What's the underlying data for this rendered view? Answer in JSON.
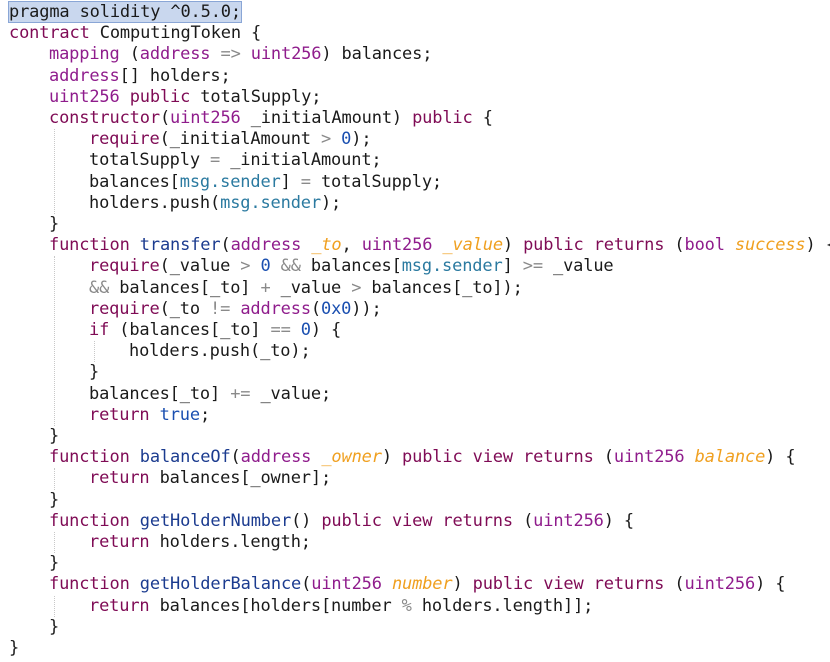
{
  "editor": {
    "language": "solidity",
    "colors": {
      "keyword": "#7f0b55",
      "type": "#8f1c8c",
      "operator": "#8a8a8a",
      "function_name": "#1b3b8f",
      "number": "#1a4fb0",
      "msg_sender": "#2b7aa0",
      "parameter": "#f0a020",
      "selection": "#c9d7ee"
    },
    "lines": [
      {
        "indent": 0,
        "tokens": [
          {
            "t": "pragma solidity ^0.5.0;",
            "c": "hl"
          }
        ]
      },
      {
        "indent": 0,
        "tokens": [
          {
            "t": "contract ",
            "c": "kw"
          },
          {
            "t": "ComputingToken {"
          }
        ]
      },
      {
        "indent": 1,
        "tokens": [
          {
            "t": "mapping",
            "c": "ty"
          },
          {
            "t": " ("
          },
          {
            "t": "address",
            "c": "ty"
          },
          {
            "t": " "
          },
          {
            "t": "=>",
            "c": "op"
          },
          {
            "t": " "
          },
          {
            "t": "uint256",
            "c": "ty"
          },
          {
            "t": ") balances;"
          }
        ]
      },
      {
        "indent": 1,
        "tokens": [
          {
            "t": "address",
            "c": "ty"
          },
          {
            "t": "[] holders;"
          }
        ]
      },
      {
        "indent": 1,
        "tokens": [
          {
            "t": "uint256",
            "c": "ty"
          },
          {
            "t": " "
          },
          {
            "t": "public",
            "c": "kw"
          },
          {
            "t": " totalSupply;"
          }
        ]
      },
      {
        "indent": 1,
        "tokens": [
          {
            "t": "constructor",
            "c": "kw"
          },
          {
            "t": "("
          },
          {
            "t": "uint256",
            "c": "ty"
          },
          {
            "t": " _initialAmount) "
          },
          {
            "t": "public",
            "c": "kw"
          },
          {
            "t": " {"
          }
        ]
      },
      {
        "indent": 2,
        "tokens": [
          {
            "t": "require",
            "c": "kw"
          },
          {
            "t": "(_initialAmount "
          },
          {
            "t": ">",
            "c": "op"
          },
          {
            "t": " "
          },
          {
            "t": "0",
            "c": "num"
          },
          {
            "t": ");"
          }
        ]
      },
      {
        "indent": 2,
        "tokens": [
          {
            "t": "totalSupply "
          },
          {
            "t": "=",
            "c": "op"
          },
          {
            "t": " _initialAmount;"
          }
        ]
      },
      {
        "indent": 2,
        "tokens": [
          {
            "t": "balances["
          },
          {
            "t": "msg.sender",
            "c": "msg"
          },
          {
            "t": "] "
          },
          {
            "t": "=",
            "c": "op"
          },
          {
            "t": " totalSupply;"
          }
        ]
      },
      {
        "indent": 2,
        "tokens": [
          {
            "t": "holders.push("
          },
          {
            "t": "msg.sender",
            "c": "msg"
          },
          {
            "t": ");"
          }
        ]
      },
      {
        "indent": 1,
        "tokens": [
          {
            "t": "}"
          }
        ]
      },
      {
        "indent": 1,
        "tokens": [
          {
            "t": "function",
            "c": "kw"
          },
          {
            "t": " "
          },
          {
            "t": "transfer",
            "c": "fn"
          },
          {
            "t": "("
          },
          {
            "t": "address",
            "c": "ty"
          },
          {
            "t": " "
          },
          {
            "t": "_to",
            "c": "prm"
          },
          {
            "t": ", "
          },
          {
            "t": "uint256",
            "c": "ty"
          },
          {
            "t": " "
          },
          {
            "t": "_value",
            "c": "prm"
          },
          {
            "t": ") "
          },
          {
            "t": "public",
            "c": "kw"
          },
          {
            "t": " "
          },
          {
            "t": "returns",
            "c": "kw"
          },
          {
            "t": " ("
          },
          {
            "t": "bool",
            "c": "ty"
          },
          {
            "t": " "
          },
          {
            "t": "success",
            "c": "prm"
          },
          {
            "t": ") {"
          }
        ]
      },
      {
        "indent": 2,
        "tokens": [
          {
            "t": "require",
            "c": "kw"
          },
          {
            "t": "(_value "
          },
          {
            "t": ">",
            "c": "op"
          },
          {
            "t": " "
          },
          {
            "t": "0",
            "c": "num"
          },
          {
            "t": " "
          },
          {
            "t": "&&",
            "c": "op"
          },
          {
            "t": " balances["
          },
          {
            "t": "msg.sender",
            "c": "msg"
          },
          {
            "t": "] "
          },
          {
            "t": ">=",
            "c": "op"
          },
          {
            "t": " _value"
          }
        ]
      },
      {
        "indent": 2,
        "tokens": [
          {
            "t": "&&",
            "c": "op"
          },
          {
            "t": " balances[_to] "
          },
          {
            "t": "+",
            "c": "op"
          },
          {
            "t": " _value "
          },
          {
            "t": ">",
            "c": "op"
          },
          {
            "t": " balances[_to]);"
          }
        ]
      },
      {
        "indent": 2,
        "tokens": [
          {
            "t": "require",
            "c": "kw"
          },
          {
            "t": "(_to "
          },
          {
            "t": "!=",
            "c": "op"
          },
          {
            "t": " "
          },
          {
            "t": "address",
            "c": "ty"
          },
          {
            "t": "("
          },
          {
            "t": "0x0",
            "c": "num"
          },
          {
            "t": "));"
          }
        ]
      },
      {
        "indent": 2,
        "tokens": [
          {
            "t": "if",
            "c": "kw"
          },
          {
            "t": " (balances[_to] "
          },
          {
            "t": "==",
            "c": "op"
          },
          {
            "t": " "
          },
          {
            "t": "0",
            "c": "num"
          },
          {
            "t": ") {"
          }
        ]
      },
      {
        "indent": 3,
        "tokens": [
          {
            "t": "holders.push(_to);"
          }
        ]
      },
      {
        "indent": 2,
        "tokens": [
          {
            "t": "}"
          }
        ]
      },
      {
        "indent": 2,
        "tokens": [
          {
            "t": "balances[_to] "
          },
          {
            "t": "+=",
            "c": "op"
          },
          {
            "t": " _value;"
          }
        ]
      },
      {
        "indent": 2,
        "tokens": [
          {
            "t": "return",
            "c": "kw"
          },
          {
            "t": " "
          },
          {
            "t": "true",
            "c": "num"
          },
          {
            "t": ";"
          }
        ]
      },
      {
        "indent": 1,
        "tokens": [
          {
            "t": "}"
          }
        ]
      },
      {
        "indent": 1,
        "tokens": [
          {
            "t": "function",
            "c": "kw"
          },
          {
            "t": " "
          },
          {
            "t": "balanceOf",
            "c": "fn"
          },
          {
            "t": "("
          },
          {
            "t": "address",
            "c": "ty"
          },
          {
            "t": " "
          },
          {
            "t": "_owner",
            "c": "prm"
          },
          {
            "t": ") "
          },
          {
            "t": "public",
            "c": "kw"
          },
          {
            "t": " "
          },
          {
            "t": "view",
            "c": "kw"
          },
          {
            "t": " "
          },
          {
            "t": "returns",
            "c": "kw"
          },
          {
            "t": " ("
          },
          {
            "t": "uint256",
            "c": "ty"
          },
          {
            "t": " "
          },
          {
            "t": "balance",
            "c": "prm"
          },
          {
            "t": ") {"
          }
        ]
      },
      {
        "indent": 2,
        "tokens": [
          {
            "t": "return",
            "c": "kw"
          },
          {
            "t": " balances[_owner];"
          }
        ]
      },
      {
        "indent": 1,
        "tokens": [
          {
            "t": "}"
          }
        ]
      },
      {
        "indent": 1,
        "tokens": [
          {
            "t": "function",
            "c": "kw"
          },
          {
            "t": " "
          },
          {
            "t": "getHolderNumber",
            "c": "fn"
          },
          {
            "t": "() "
          },
          {
            "t": "public",
            "c": "kw"
          },
          {
            "t": " "
          },
          {
            "t": "view",
            "c": "kw"
          },
          {
            "t": " "
          },
          {
            "t": "returns",
            "c": "kw"
          },
          {
            "t": " ("
          },
          {
            "t": "uint256",
            "c": "ty"
          },
          {
            "t": ") {"
          }
        ]
      },
      {
        "indent": 2,
        "tokens": [
          {
            "t": "return",
            "c": "kw"
          },
          {
            "t": " holders.length;"
          }
        ]
      },
      {
        "indent": 1,
        "tokens": [
          {
            "t": "}"
          }
        ]
      },
      {
        "indent": 1,
        "tokens": [
          {
            "t": "function",
            "c": "kw"
          },
          {
            "t": " "
          },
          {
            "t": "getHolderBalance",
            "c": "fn"
          },
          {
            "t": "("
          },
          {
            "t": "uint256",
            "c": "ty"
          },
          {
            "t": " "
          },
          {
            "t": "number",
            "c": "prm"
          },
          {
            "t": ") "
          },
          {
            "t": "public",
            "c": "kw"
          },
          {
            "t": " "
          },
          {
            "t": "view",
            "c": "kw"
          },
          {
            "t": " "
          },
          {
            "t": "returns",
            "c": "kw"
          },
          {
            "t": " ("
          },
          {
            "t": "uint256",
            "c": "ty"
          },
          {
            "t": ") {"
          }
        ]
      },
      {
        "indent": 2,
        "tokens": [
          {
            "t": "return",
            "c": "kw"
          },
          {
            "t": " balances[holders[number "
          },
          {
            "t": "%",
            "c": "op"
          },
          {
            "t": " holders.length]];"
          }
        ]
      },
      {
        "indent": 1,
        "tokens": [
          {
            "t": "}"
          }
        ]
      },
      {
        "indent": 0,
        "tokens": [
          {
            "t": "}"
          }
        ]
      }
    ]
  }
}
